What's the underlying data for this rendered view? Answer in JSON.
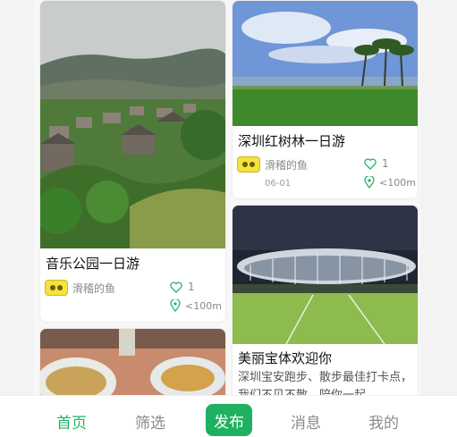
{
  "cards": [
    {
      "title": "音乐公园一日游",
      "author": "滑稽的鱼",
      "likes": "1",
      "distance": "<100m"
    },
    {
      "title": "深圳红树林一日游",
      "author": "滑稽的鱼",
      "likes": "1",
      "distance": "<100m",
      "date": "06-01"
    },
    {
      "title": "美丽宝体欢迎你",
      "description": "深圳宝安跑步、散步最佳打卡点，我们不见不散，陪你一起"
    },
    {
      "title": ""
    }
  ],
  "tabs": {
    "home": "首页",
    "filter": "筛选",
    "publish": "发布",
    "messages": "消息",
    "mine": "我的"
  },
  "colors": {
    "accent": "#22b364",
    "publish_bg": "#1fb160"
  }
}
